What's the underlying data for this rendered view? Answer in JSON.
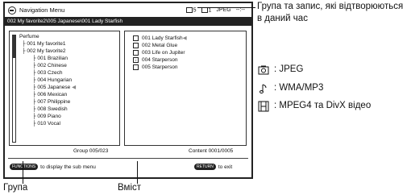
{
  "topbar": {
    "title": "Navigation Menu",
    "group_total": "5",
    "content_total": "1",
    "file_type": "JPEG",
    "time": "--:--"
  },
  "path": "002 My favorite2\\005 Japanese\\001 Lady Starfish",
  "groups": [
    {
      "label": "Perfume",
      "level": 0
    },
    {
      "label": "001 My favorite1",
      "level": 1
    },
    {
      "label": "002 My favorite2",
      "level": 1
    },
    {
      "label": "001 Brazilian",
      "level": 2
    },
    {
      "label": "002 Chinese",
      "level": 2
    },
    {
      "label": "003 Czech",
      "level": 2
    },
    {
      "label": "004 Hungarian",
      "level": 2
    },
    {
      "label": "005 Japanese",
      "level": 2
    },
    {
      "label": "006 Mexican",
      "level": 2
    },
    {
      "label": "007 Philippine",
      "level": 2
    },
    {
      "label": "008 Swedish",
      "level": 2
    },
    {
      "label": "009 Piano",
      "level": 2
    },
    {
      "label": "010 Vocal",
      "level": 2
    }
  ],
  "contents": [
    {
      "label": "001 Lady Starfish",
      "icon": "video-icon"
    },
    {
      "label": "002 Metal Glue",
      "icon": "video-icon"
    },
    {
      "label": "003 Life on Jupiter",
      "icon": "video-icon"
    },
    {
      "label": "004 Starperson",
      "icon": "music-note-icon"
    },
    {
      "label": "005 Starperson",
      "icon": "video-icon"
    }
  ],
  "status": {
    "group": "Group 005/023",
    "content": "Content 0001/0005"
  },
  "footer": {
    "functions_btn": "FUNCTIONS",
    "functions_text": "to display the sub menu",
    "return_btn": "RETURN",
    "return_text": "to exit"
  },
  "callouts": {
    "current_group_content": "Група та запис, які відтворюються в даний час",
    "jpeg": ": JPEG",
    "wma_mp3": ": WMA/MP3",
    "video": ":  MPEG4 та DivX відео",
    "group": "Група",
    "content": "Вміст"
  }
}
